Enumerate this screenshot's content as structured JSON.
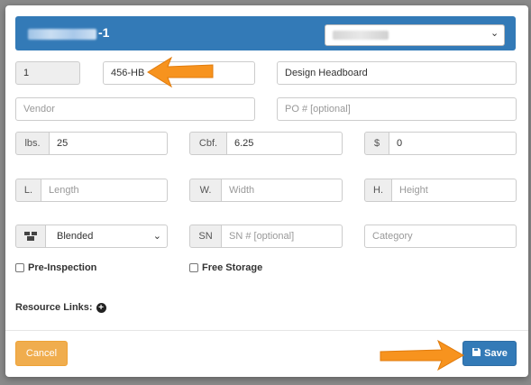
{
  "modal": {
    "title_suffix": "-1",
    "header_select_icon": "chevron-down-icon"
  },
  "row1": {
    "quantity": "1",
    "sku": "456-HB",
    "description": "Design Headboard"
  },
  "row2": {
    "vendor_placeholder": "Vendor",
    "po_placeholder": "PO # [optional]"
  },
  "row3": {
    "weight_addon": "lbs.",
    "weight_value": "25",
    "volume_addon": "Cbf.",
    "volume_value": "6.25",
    "price_addon": "$",
    "price_value": "0"
  },
  "row4": {
    "length_addon": "L.",
    "length_placeholder": "Length",
    "width_addon": "W.",
    "width_placeholder": "Width",
    "height_addon": "H.",
    "height_placeholder": "Height"
  },
  "row5": {
    "packaging_icon": "boxes-icon",
    "packaging_value": "Blended",
    "sn_addon": "SN",
    "sn_placeholder": "SN # [optional]",
    "category_placeholder": "Category"
  },
  "checks": {
    "pre_inspection": "Pre-Inspection",
    "free_storage": "Free Storage"
  },
  "resources": {
    "label": "Resource Links:",
    "add_icon": "plus-circle-icon"
  },
  "footer": {
    "cancel_label": "Cancel",
    "save_label": "Save",
    "save_icon": "save-icon"
  },
  "colors": {
    "header": "#337ab7",
    "cancel": "#f0ad4e",
    "save": "#337ab7",
    "arrow": "#f7931e"
  }
}
